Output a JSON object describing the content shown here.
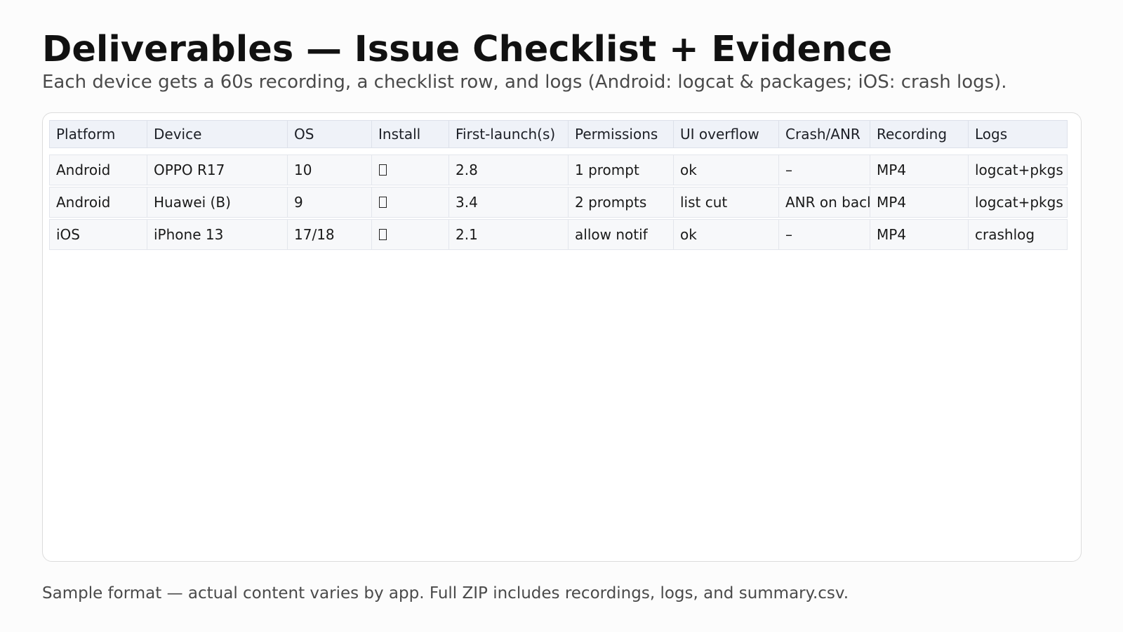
{
  "page": {
    "title": "Deliverables — Issue Checklist + Evidence",
    "subtitle": "Each device gets a 60s recording, a checklist row, and logs (Android: logcat & packages; iOS: crash logs).",
    "footer": "Sample format — actual content varies by app. Full ZIP includes recordings, logs, and summary.csv."
  },
  "table": {
    "headers": [
      "Platform",
      "Device",
      "OS",
      "Install",
      "First-launch(s)",
      "Permissions",
      "UI overflow",
      "Crash/ANR",
      "Recording",
      "Logs"
    ],
    "rows": [
      [
        "Android",
        "OPPO R17",
        "10",
        "check-glyph",
        "2.8",
        "1 prompt",
        "ok",
        "–",
        "MP4",
        "logcat+pkgs"
      ],
      [
        "Android",
        "Huawei (B)",
        "9",
        "check-glyph",
        "3.4",
        "2 prompts",
        "list cut",
        "ANR on back",
        "MP4",
        "logcat+pkgs"
      ],
      [
        "iOS",
        "iPhone 13",
        "17/18",
        "check-glyph",
        "2.1",
        "allow notif",
        "ok",
        "–",
        "MP4",
        "crashlog"
      ]
    ]
  }
}
